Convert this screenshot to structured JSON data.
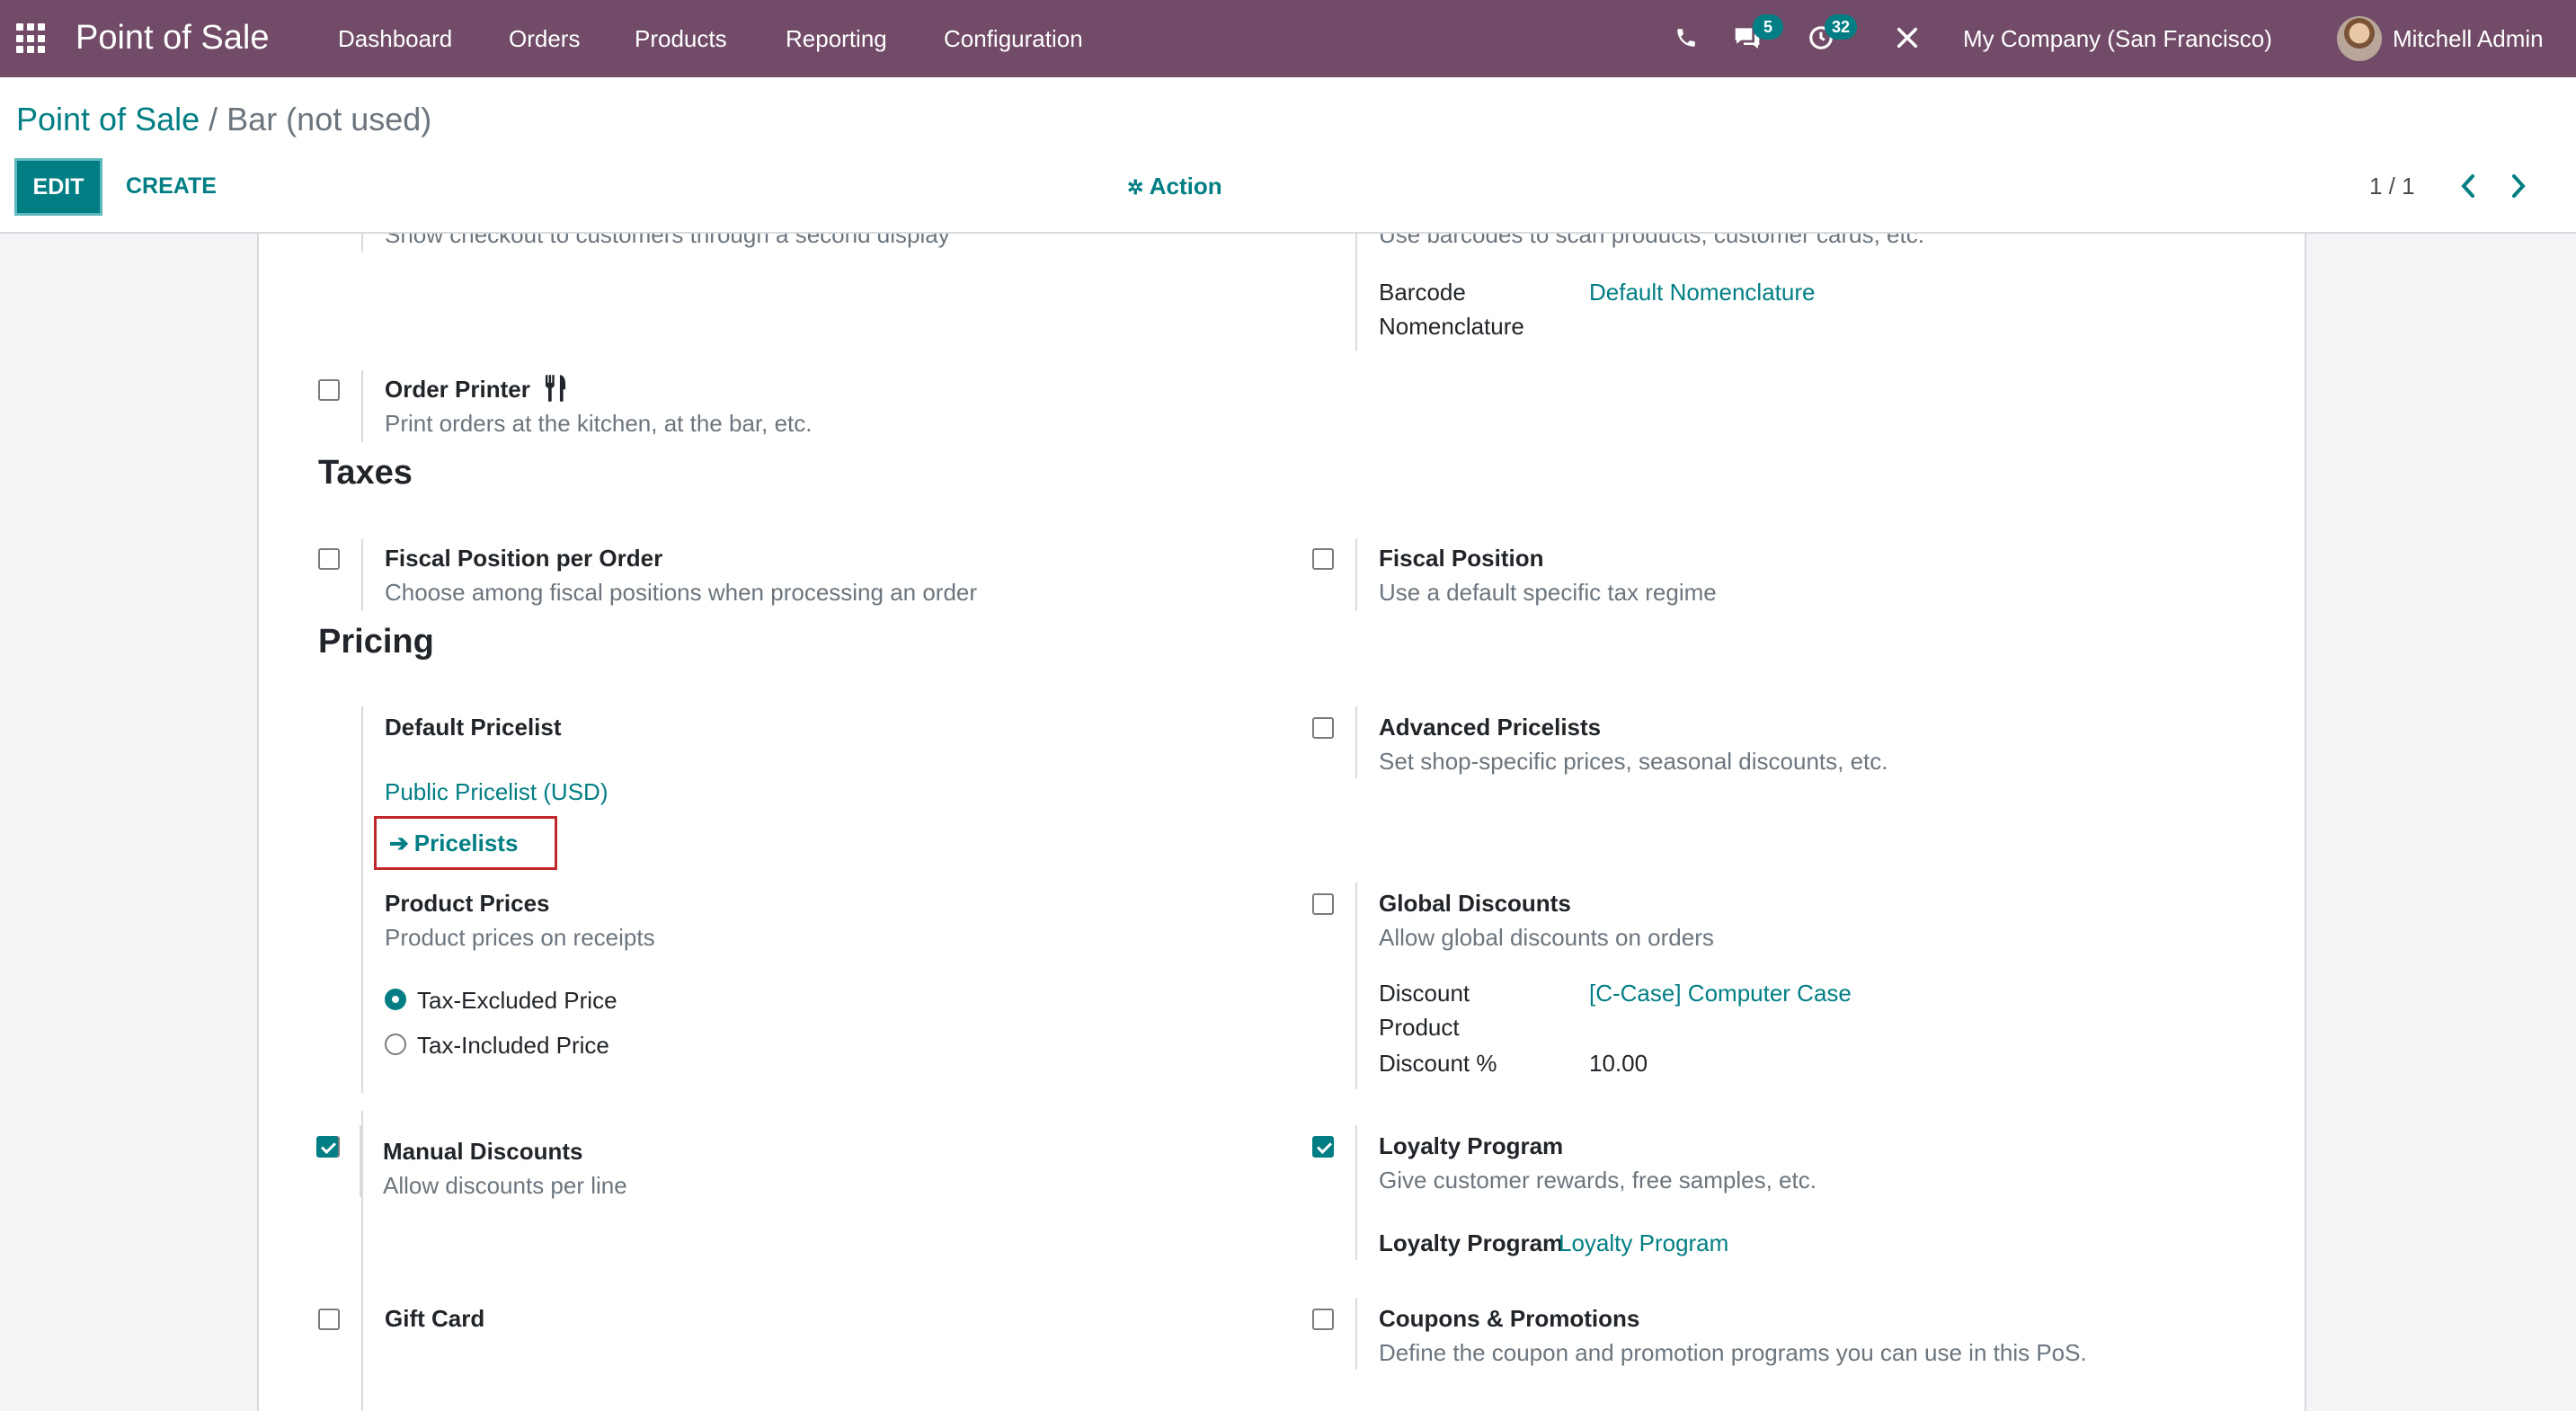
{
  "navbar": {
    "app_title": "Point of Sale",
    "menu": [
      "Dashboard",
      "Orders",
      "Products",
      "Reporting",
      "Configuration"
    ],
    "messages_badge": "5",
    "activities_badge": "32",
    "company": "My Company (San Francisco)",
    "user": "Mitchell Admin",
    "icons": [
      "apps-grid-icon",
      "phone-icon",
      "chat-icon",
      "clock-icon",
      "tools-icon"
    ]
  },
  "control_panel": {
    "breadcrumb_root": "Point of Sale",
    "breadcrumb_sep": " / ",
    "breadcrumb_current": "Bar (not used)",
    "edit_label": "EDIT",
    "create_label": "CREATE",
    "action_label": "Action",
    "pager": "1 / 1"
  },
  "top_partial": {
    "left_desc": "Show checkout to customers through a second display",
    "right_desc": "Use barcodes to scan products, customer cards, etc.",
    "barcode_label_1": "Barcode",
    "barcode_label_2": "Nomenclature",
    "barcode_value": "Default Nomenclature"
  },
  "order_printer": {
    "label": "Order Printer",
    "desc": "Print orders at the kitchen, at the bar, etc."
  },
  "taxes": {
    "title": "Taxes",
    "fiscal_per_order_label": "Fiscal Position per Order",
    "fiscal_per_order_desc": "Choose among fiscal positions when processing an order",
    "fiscal_position_label": "Fiscal Position",
    "fiscal_position_desc": "Use a default specific tax regime"
  },
  "pricing": {
    "title": "Pricing",
    "default_pricelist_label": "Default Pricelist",
    "default_pricelist_value": "Public Pricelist (USD)",
    "pricelists_link": "Pricelists",
    "advanced_label": "Advanced Pricelists",
    "advanced_desc": "Set shop-specific prices, seasonal discounts, etc.",
    "product_prices_label": "Product Prices",
    "product_prices_desc": "Product prices on receipts",
    "radio_excluded": "Tax-Excluded Price",
    "radio_included": "Tax-Included Price",
    "global_discounts_label": "Global Discounts",
    "global_discounts_desc": "Allow global discounts on orders",
    "discount_product_label_1": "Discount",
    "discount_product_label_2": "Product",
    "discount_product_value": "[C-Case] Computer Case",
    "discount_pct_label": "Discount %",
    "discount_pct_value": "10.00",
    "manual_discounts_label": "Manual Discounts",
    "manual_discounts_desc": "Allow discounts per line",
    "loyalty_label": "Loyalty Program",
    "loyalty_desc": "Give customer rewards, free samples, etc.",
    "loyalty_field_label": "Loyalty Program",
    "loyalty_field_value": "Loyalty Program",
    "gift_card_label": "Gift Card",
    "coupons_label": "Coupons & Promotions",
    "coupons_desc": "Define the coupon and promotion programs you can use in this PoS."
  },
  "colors": {
    "navbar": "#714b67",
    "accent": "#017e84",
    "highlight_border": "#c0282d"
  }
}
